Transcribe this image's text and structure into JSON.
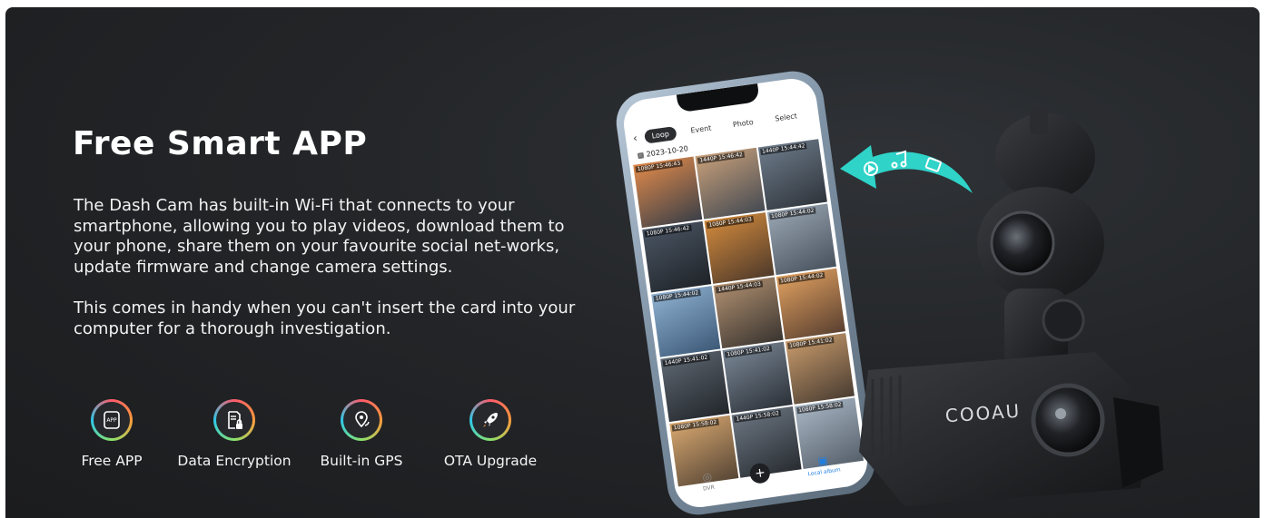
{
  "title": "Free Smart APP",
  "paragraphs": [
    "The Dash Cam has built-in Wi-Fi that connects to your smartphone, allowing you to play videos, download them to your phone, share them on your favourite social net-works, update firmware and change camera settings.",
    "This comes in handy when you can't insert the card into your computer for a thorough investigation."
  ],
  "features": [
    {
      "label": "Free APP",
      "icon": "app-icon"
    },
    {
      "label": "Data Encryption",
      "icon": "lock-document-icon"
    },
    {
      "label": "Built-in GPS",
      "icon": "gps-pin-icon"
    },
    {
      "label": "OTA Upgrade",
      "icon": "rocket-icon"
    }
  ],
  "phone_app": {
    "tabs": [
      "Loop",
      "Event",
      "Photo",
      "Select"
    ],
    "active_tab": "Loop",
    "date": "2023-10-20",
    "thumbnails": [
      "1080P 15:46:43",
      "1440P 15:46:42",
      "1440P 15:44:42",
      "1080P 15:46:42",
      "1080P 15:44:03",
      "1080P 15:44:02",
      "1080P 15:44:02",
      "1440P 15:44:03",
      "1080P 15:44:02",
      "1440P 15:41:02",
      "1080P 15:41:02",
      "1080P 15:41:02",
      "1080P 15:58:02",
      "1440P 15:58:02",
      "1080P 15:58:02"
    ],
    "nav": {
      "dvr": "DVR",
      "local_album": "Local album"
    }
  },
  "camera_brand": "COOAU",
  "colors": {
    "accent_teal": "#2fd3c8",
    "background": "#222427"
  }
}
